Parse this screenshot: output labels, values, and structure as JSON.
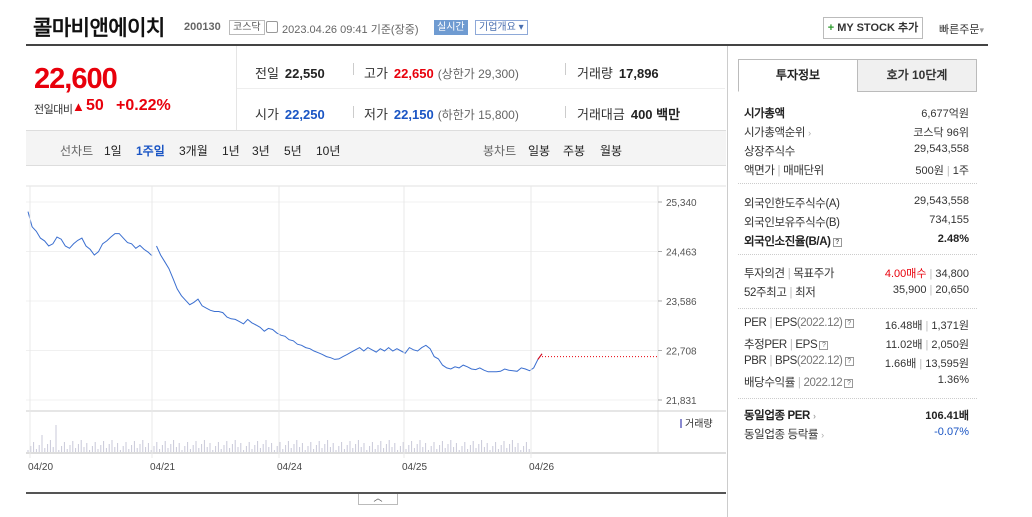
{
  "header": {
    "name": "콜마비앤에이치",
    "code": "200130",
    "market": "코스닥",
    "datetime": "2023.04.26 09:41 기준(장중)",
    "realtime": "실시간",
    "corp_info": "기업개요",
    "corp_info_arrow": "▾",
    "mystock_plus": "+",
    "mystock": "MY STOCK 추가",
    "quick_order": "빠른주문",
    "quick_arrow": "▾"
  },
  "price": {
    "current": "22,600",
    "diff_label": "전일대비",
    "diff_arrow": "▲",
    "diff": "50",
    "rate": "+0.22%"
  },
  "stats": {
    "prev_close_label": "전일",
    "prev_close": "22,550",
    "high_label": "고가",
    "high": "22,650",
    "upper_limit": "(상한가 29,300)",
    "volume_label": "거래량",
    "volume": "17,896",
    "open_label": "시가",
    "open": "22,250",
    "low_label": "저가",
    "low": "22,150",
    "lower_limit": "(하한가 15,800)",
    "amount_label": "거래대금",
    "amount": "400 백만"
  },
  "chart_tabs": {
    "line_label": "선차트",
    "line_items": [
      "1일",
      "1주일",
      "3개월",
      "1년",
      "3년",
      "5년",
      "10년"
    ],
    "selected": "1주일",
    "candle_label": "봉차트",
    "candle_items": [
      "일봉",
      "주봉",
      "월봉"
    ]
  },
  "chart_data": {
    "type": "line",
    "title": "",
    "xlabel": "",
    "ylabel": "",
    "x_ticks": [
      "04/20",
      "04/21",
      "04/24",
      "04/25",
      "04/26"
    ],
    "y_ticks": [
      25340,
      24463,
      23586,
      22708,
      21831
    ],
    "ylim": [
      21831,
      25340
    ],
    "volume_label": "거래량",
    "current": 22600,
    "series": [
      {
        "name": "",
        "color": "#3b6fd0",
        "values": [
          25170,
          24900,
          24820,
          24700,
          24650,
          24560,
          24600,
          24720,
          24680,
          24560,
          24520,
          24600,
          24660,
          24700,
          24560,
          24500,
          24400,
          24460,
          24600,
          24650,
          24720,
          24780,
          24780,
          24700,
          24620,
          24600,
          24520,
          24570,
          24500,
          24450,
          24380,
          24560,
          24400,
          24280,
          24160,
          23980,
          23800,
          23680,
          23600,
          23520,
          23560,
          23620,
          23500,
          23460,
          23420,
          23400,
          23400,
          23380,
          23300,
          23270,
          23260,
          23220,
          23180,
          23260,
          23200,
          23160,
          23120,
          23050,
          23100,
          23080,
          23020,
          22980,
          22960,
          22900,
          22880,
          22820,
          22800,
          22760,
          22740,
          22700,
          22670,
          22640,
          22600,
          22580,
          22550,
          22560,
          22600,
          22640,
          22680,
          22720,
          22760,
          22700,
          22760,
          22720,
          22680,
          22740,
          22700,
          22760,
          22700,
          22740,
          22700,
          22660,
          22760,
          22720,
          22700,
          22760,
          22800,
          22740,
          22600,
          22560,
          22450,
          22400,
          22380,
          22420,
          22400,
          22450,
          22420,
          22380,
          22370,
          22400,
          22360,
          22330,
          22330,
          22330,
          22340,
          22380,
          22360,
          22350,
          22340,
          22400,
          22380,
          22350,
          22400,
          22550,
          22650
        ]
      }
    ]
  },
  "right": {
    "tabs": [
      "투자정보",
      "호가 10단계"
    ],
    "market_cap_label": "시가총액",
    "market_cap": "6,677억원",
    "cap_rank_label": "시가총액순위",
    "cap_rank": "코스닥 96위",
    "shares_label": "상장주식수",
    "shares": "29,543,558",
    "face_label": "액면가",
    "lot_label": "매매단위",
    "face": "500원",
    "lot": "1주",
    "foreign_limit_label": "외국인한도주식수(A)",
    "foreign_limit": "29,543,558",
    "foreign_hold_label": "외국인보유주식수(B)",
    "foreign_hold": "734,155",
    "foreign_ratio_label": "외국인소진율(B/A)",
    "foreign_ratio": "2.48%",
    "opinion_label": "투자의견",
    "target_label": "목표주가",
    "opinion": "4.00매수",
    "target": "34,800",
    "w52_high_label": "52주최고",
    "w52_low_label": "최저",
    "w52_high": "35,900",
    "w52_low": "20,650",
    "per_label": "PER",
    "eps_label": "EPS",
    "eps_period": "(2022.12)",
    "per": "16.48배",
    "eps": "1,371원",
    "est_per_label": "추정PER",
    "est_eps_label": "EPS",
    "est_per": "11.02배",
    "est_eps": "2,050원",
    "pbr_label": "PBR",
    "bps_label": "BPS",
    "bps_period": "(2022.12)",
    "pbr": "1.66배",
    "bps": "13,595원",
    "div_label": "배당수익률",
    "div_period": "2022.12",
    "div": "1.36%",
    "ind_per_label": "동일업종 PER",
    "ind_per": "106.41배",
    "ind_rate_label": "동일업종 등락률",
    "ind_rate": "-0.07%"
  }
}
